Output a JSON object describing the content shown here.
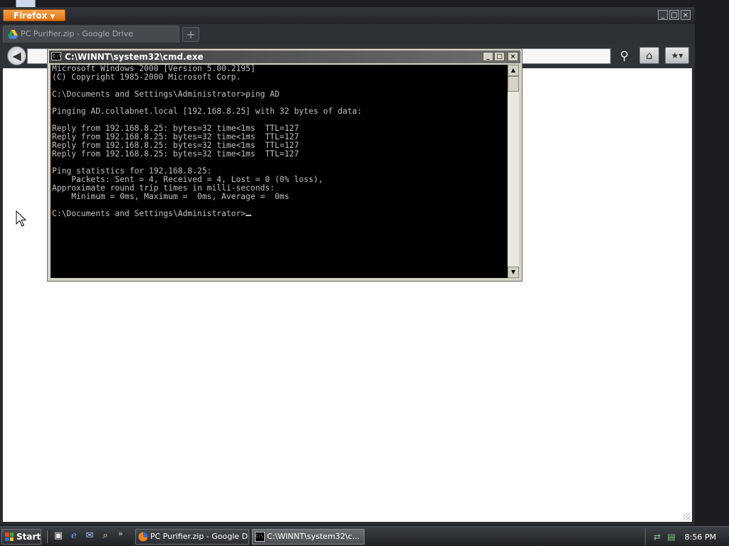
{
  "firefox": {
    "menu_button_label": "Firefox",
    "tab_title": "PC Purifier.zip - Google Drive",
    "new_tab_symbol": "+",
    "url_value": "",
    "window_controls": [
      "_",
      "□",
      "×"
    ]
  },
  "cmd": {
    "title": "C:\\WINNT\\system32\\cmd.exe",
    "window_controls": [
      "_",
      "□",
      "×"
    ],
    "lines": [
      "Microsoft Windows 2000 [Version 5.00.2195]",
      "(C) Copyright 1985-2000 Microsoft Corp.",
      "",
      "C:\\Documents and Settings\\Administrator>ping AD",
      "",
      "Pinging AD.collabnet.local [192.168.8.25] with 32 bytes of data:",
      "",
      "Reply from 192.168.8.25: bytes=32 time<1ms  TTL=127",
      "Reply from 192.168.8.25: bytes=32 time<1ms  TTL=127",
      "Reply from 192.168.8.25: bytes=32 time<1ms  TTL=127",
      "Reply from 192.168.8.25: bytes=32 time<1ms  TTL=127",
      "",
      "Ping statistics for 192.168.8.25:",
      "    Packets: Sent = 4, Received = 4, Lost = 0 (0% loss),",
      "Approximate round trip times in milli-seconds:",
      "    Minimum = 0ms, Maximum =  0ms, Average =  0ms",
      "",
      "C:\\Documents and Settings\\Administrator>"
    ]
  },
  "taskbar": {
    "start_label": "Start",
    "more_symbol": "»",
    "tasks": [
      {
        "label": "PC Purifier.zip - Google Dr...",
        "active": false
      },
      {
        "label": "C:\\WINNT\\system32\\c...",
        "active": true
      }
    ],
    "clock": "8:56 PM"
  },
  "colors": {
    "firefox_orange": "#e8821e",
    "cmd_background": "#000000",
    "cmd_text": "#c0c0c0",
    "content_background": "#ffffff"
  }
}
